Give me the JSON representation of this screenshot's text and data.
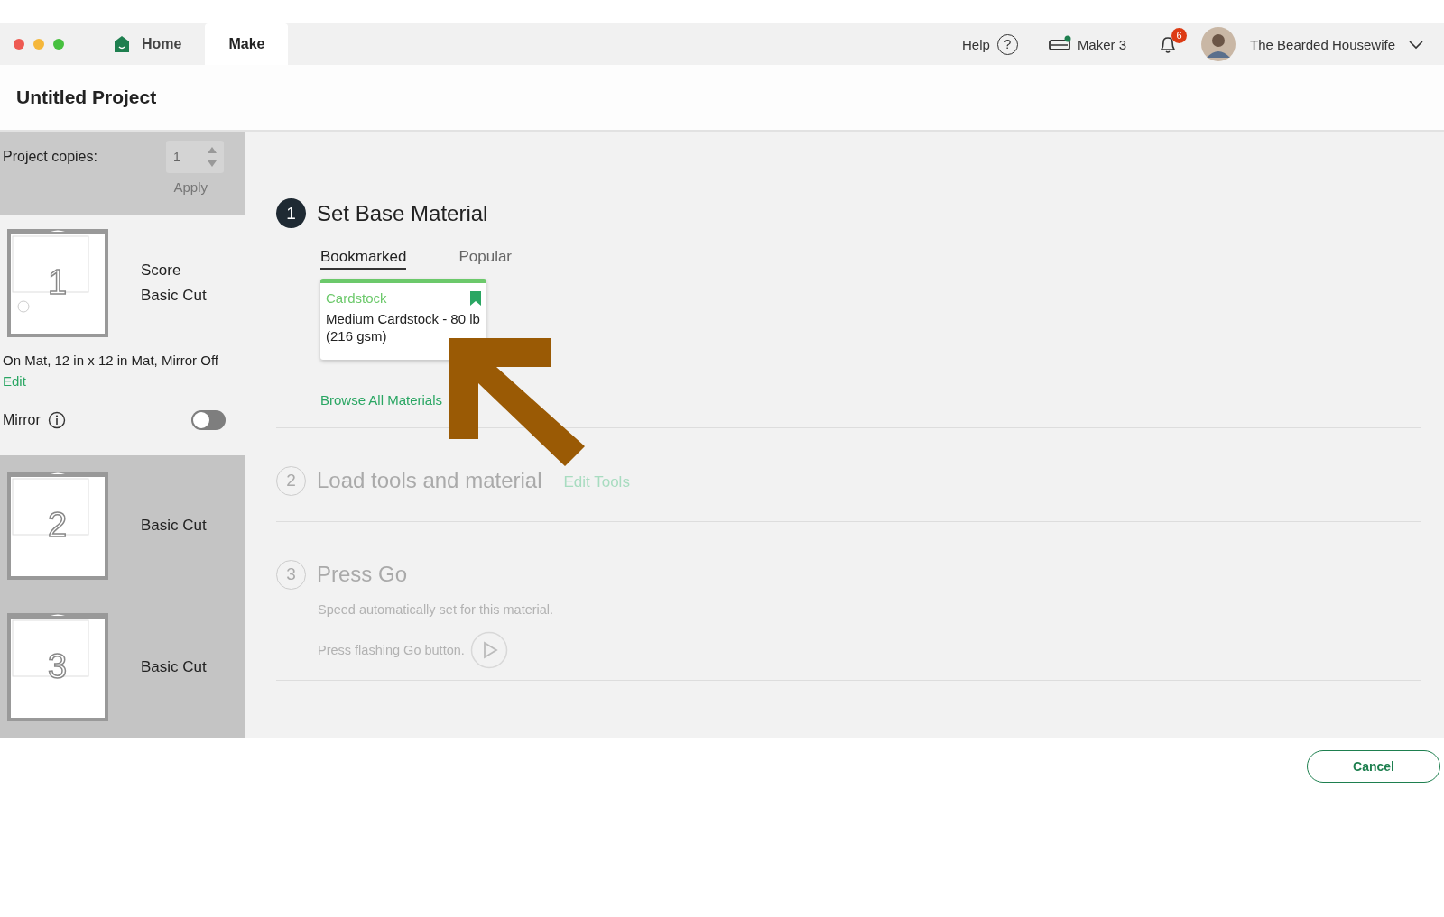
{
  "titlebar": {
    "tabs": [
      {
        "label": "Home",
        "icon": true,
        "selected": false
      },
      {
        "label": "Make",
        "icon": false,
        "selected": true
      }
    ],
    "help": "Help",
    "help_icon": "?",
    "machine": "Maker 3",
    "notifications": "6",
    "user": "The Bearded Housewife"
  },
  "project": {
    "title": "Untitled Project"
  },
  "sidebar": {
    "copies_label": "Project copies:",
    "copies_value": "1",
    "apply": "Apply",
    "mats": [
      {
        "number": "1",
        "lines": [
          "Score",
          "Basic Cut"
        ],
        "selected": true
      },
      {
        "number": "2",
        "lines": [
          "Basic Cut"
        ],
        "selected": false
      },
      {
        "number": "3",
        "lines": [
          "Basic Cut"
        ],
        "selected": false
      }
    ],
    "mat_info": "On Mat, 12 in x 12 in Mat, Mirror Off",
    "edit": "Edit",
    "mirror": {
      "label": "Mirror",
      "on": false
    }
  },
  "steps": [
    {
      "number": "1",
      "title": "Set Base Material",
      "active": true,
      "kind": "material"
    },
    {
      "number": "2",
      "title": "Load tools and material",
      "active": false,
      "kind": "tools",
      "link": "Edit Tools"
    },
    {
      "number": "3",
      "title": "Press Go",
      "active": false,
      "kind": "go",
      "notes": [
        "Speed automatically set for this material.",
        "Press flashing Go button."
      ]
    }
  ],
  "material": {
    "tabs": [
      {
        "label": "Bookmarked",
        "selected": true
      },
      {
        "label": "Popular",
        "selected": false
      }
    ],
    "card": {
      "category": "Cardstock",
      "name": "Medium Cardstock - 80 lb (216 gsm)",
      "bookmarked": true
    },
    "browse": "Browse All Materials"
  },
  "footer": {
    "cancel": "Cancel"
  }
}
